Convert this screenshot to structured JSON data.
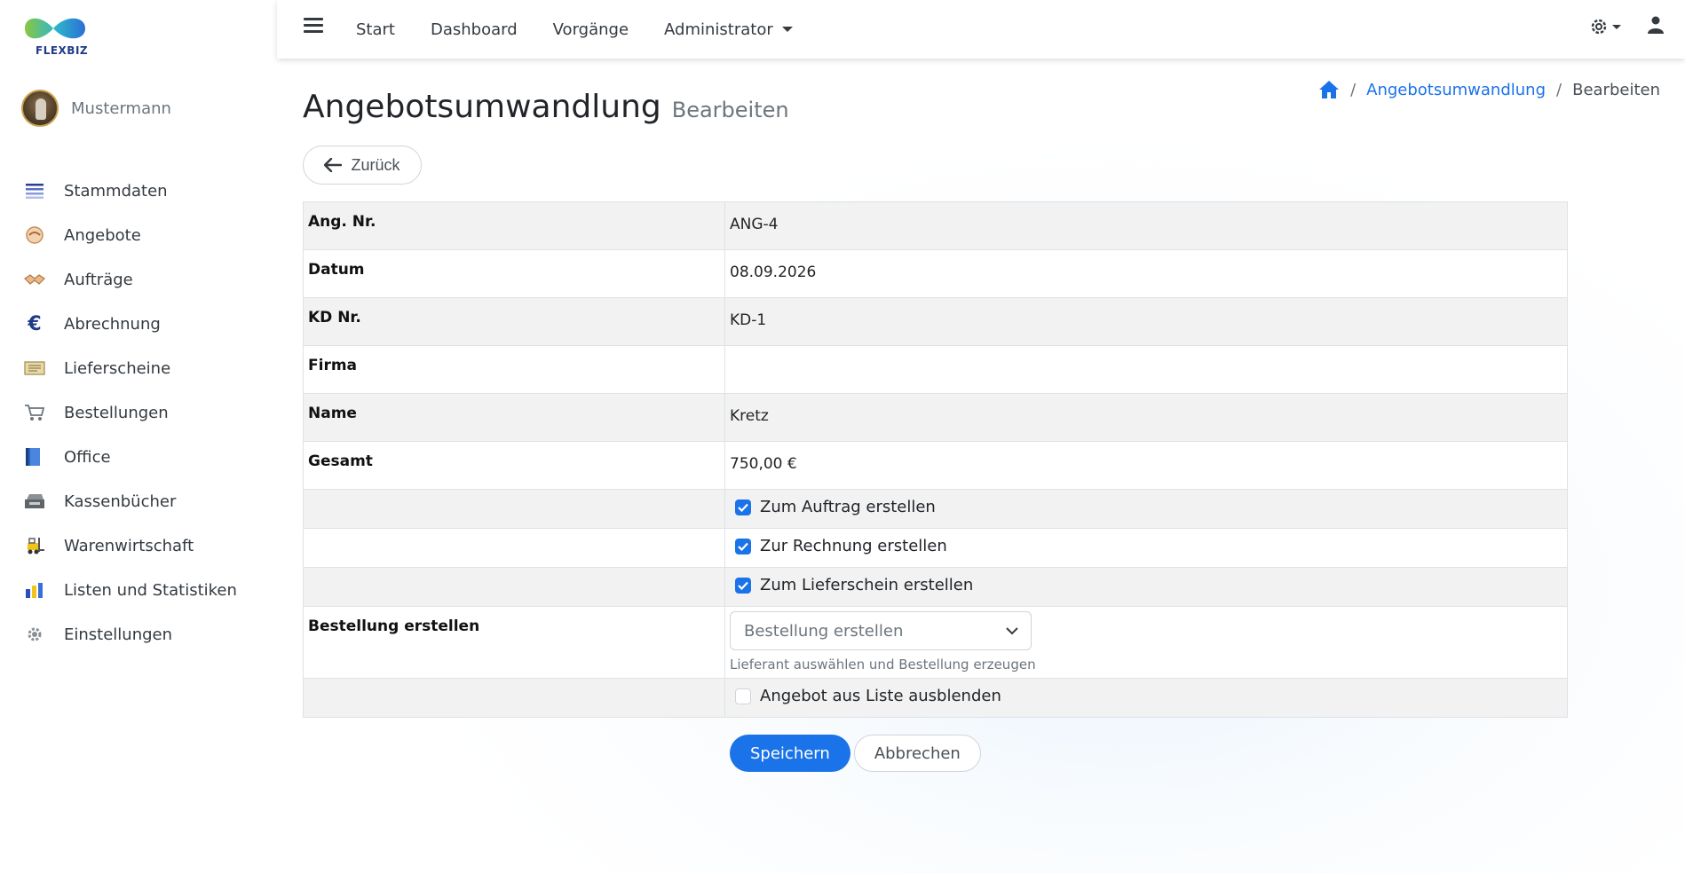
{
  "app": {
    "logo_text": "FLEXBIZ"
  },
  "user": {
    "name": "Mustermann"
  },
  "sidebar": {
    "items": [
      {
        "label": "Stammdaten",
        "icon": "list-icon"
      },
      {
        "label": "Angebote",
        "icon": "handshake-offer-icon"
      },
      {
        "label": "Aufträge",
        "icon": "handshake-icon"
      },
      {
        "label": "Abrechnung",
        "icon": "euro-icon"
      },
      {
        "label": "Lieferscheine",
        "icon": "delivery-note-icon"
      },
      {
        "label": "Bestellungen",
        "icon": "cart-icon"
      },
      {
        "label": "Office",
        "icon": "office-book-icon"
      },
      {
        "label": "Kassenbücher",
        "icon": "cashbox-icon"
      },
      {
        "label": "Warenwirtschaft",
        "icon": "forklift-icon"
      },
      {
        "label": "Listen und Statistiken",
        "icon": "bar-chart-icon"
      },
      {
        "label": "Einstellungen",
        "icon": "gear-icon"
      }
    ]
  },
  "topnav": {
    "items": [
      {
        "label": "Start"
      },
      {
        "label": "Dashboard"
      },
      {
        "label": "Vorgänge"
      },
      {
        "label": "Administrator",
        "dropdown": true
      }
    ]
  },
  "page": {
    "title": "Angebotsumwandlung",
    "subtitle": "Bearbeiten",
    "back_label": "Zurück"
  },
  "breadcrumb": {
    "link": "Angebotsumwandlung",
    "current": "Bearbeiten"
  },
  "form": {
    "fields": [
      {
        "label": "Ang. Nr.",
        "value": "ANG-4"
      },
      {
        "label": "Datum",
        "value": "08.09.2026"
      },
      {
        "label": "KD Nr.",
        "value": "KD-1"
      },
      {
        "label": "Firma",
        "value": ""
      },
      {
        "label": "Name",
        "value": "Kretz"
      },
      {
        "label": "Gesamt",
        "value": "750,00 €"
      }
    ],
    "checkboxes": [
      {
        "label": "Zum Auftrag erstellen",
        "checked": true
      },
      {
        "label": "Zur Rechnung erstellen",
        "checked": true
      },
      {
        "label": "Zum Lieferschein erstellen",
        "checked": true
      }
    ],
    "bestellung": {
      "label": "Bestellung erstellen",
      "placeholder": "Bestellung erstellen",
      "help": "Lieferant auswählen und Bestellung erzeugen"
    },
    "hide_checkbox": {
      "label": "Angebot aus Liste ausblenden",
      "checked": false
    }
  },
  "actions": {
    "save_label": "Speichern",
    "cancel_label": "Abbrechen"
  },
  "colors": {
    "primary": "#1a73e8",
    "text": "#212529",
    "muted": "#6c757d",
    "row_stripe": "#f2f2f2"
  }
}
